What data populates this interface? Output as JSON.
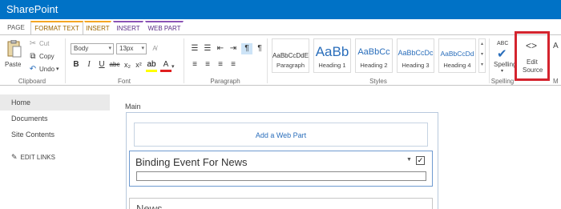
{
  "app": {
    "brand": "SharePoint"
  },
  "tabs": [
    {
      "label": "PAGE"
    },
    {
      "label": "FORMAT TEXT"
    },
    {
      "label": "INSERT"
    },
    {
      "label": "INSERT"
    },
    {
      "label": "WEB PART"
    }
  ],
  "ribbon": {
    "clipboard": {
      "paste": "Paste",
      "cut": "Cut",
      "copy": "Copy",
      "undo": "Undo",
      "label": "Clipboard"
    },
    "font": {
      "style_value": "Body",
      "size_value": "13px",
      "label": "Font"
    },
    "paragraph": {
      "label": "Paragraph"
    },
    "styles": {
      "label": "Styles",
      "tiles": [
        {
          "sample": "AaBbCcDdE",
          "name": "Paragraph"
        },
        {
          "sample": "AaBb",
          "name": "Heading 1"
        },
        {
          "sample": "AaBbCc",
          "name": "Heading 2"
        },
        {
          "sample": "AaBbCcDc",
          "name": "Heading 3"
        },
        {
          "sample": "AaBbCcDd",
          "name": "Heading 4"
        }
      ]
    },
    "spelling": {
      "abc": "ABC",
      "label": "Spelling",
      "group_label": "Spelling"
    },
    "markup": {
      "line1": "Edit",
      "line2": "Source",
      "cutoff_letter": "A",
      "cutoff_group": "M"
    }
  },
  "nav": {
    "items": [
      "Home",
      "Documents",
      "Site Contents"
    ],
    "edit_links": "EDIT LINKS"
  },
  "main": {
    "zone_label": "Main",
    "add_webpart": "Add a Web Part",
    "webpart_title": "Binding Event For News",
    "next_part_title": "News"
  },
  "colors": {
    "suite_bar": "#0072c6",
    "highlight": "#d4242e",
    "link": "#2a6ebb"
  }
}
